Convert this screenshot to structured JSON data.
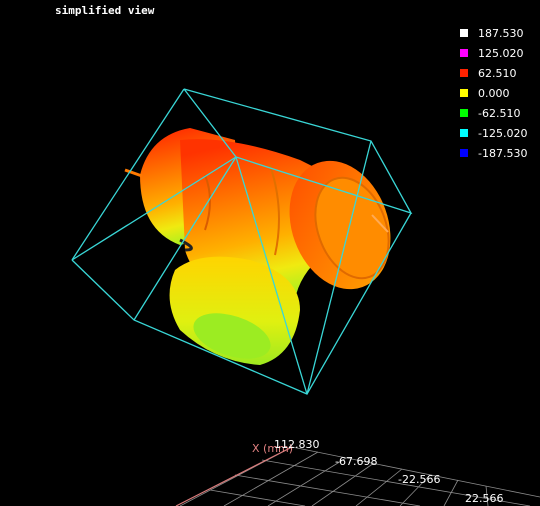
{
  "viewport": {
    "title": "simplified view"
  },
  "legend": {
    "items": [
      {
        "label": "187.530",
        "color": "#ffffff"
      },
      {
        "label": "125.020",
        "color": "#ff00ff"
      },
      {
        "label": "62.510",
        "color": "#ff2200"
      },
      {
        "label": "0.000",
        "color": "#ffff00"
      },
      {
        "label": "-62.510",
        "color": "#00ff00"
      },
      {
        "label": "-125.020",
        "color": "#00ffff"
      },
      {
        "label": "-187.530",
        "color": "#0000ff"
      }
    ]
  },
  "axes": {
    "x_label": "X (mm)",
    "ticks": [
      "112.830",
      "-67.698",
      "-22.566",
      "22.566"
    ]
  },
  "colors": {
    "bounding_box": "#39d6d6",
    "grid": "#9a9a9a",
    "x_axis": "#d97a7a"
  }
}
